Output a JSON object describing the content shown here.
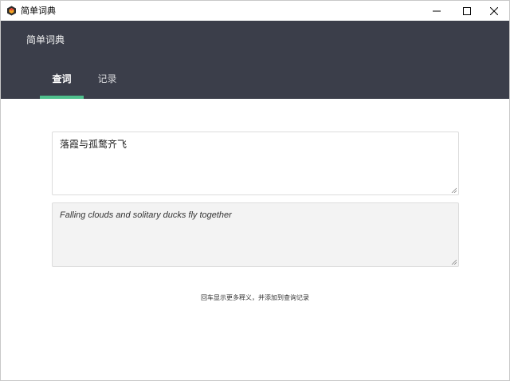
{
  "window": {
    "title": "简单词典",
    "icon": "app-logo-icon",
    "controls": [
      "minimize-icon",
      "maximize-icon",
      "close-icon"
    ]
  },
  "header": {
    "title": "简单词典",
    "background": "#3b3e4a"
  },
  "tabs": [
    {
      "label": "查词",
      "active": true
    },
    {
      "label": "记录",
      "active": false
    }
  ],
  "accent_color": "#4fc08d",
  "query": {
    "value": "落霞与孤鹜齐飞"
  },
  "result": {
    "value": "Falling clouds and solitary ducks fly together"
  },
  "hint": "回车显示更多释义，并添加到查询记录"
}
